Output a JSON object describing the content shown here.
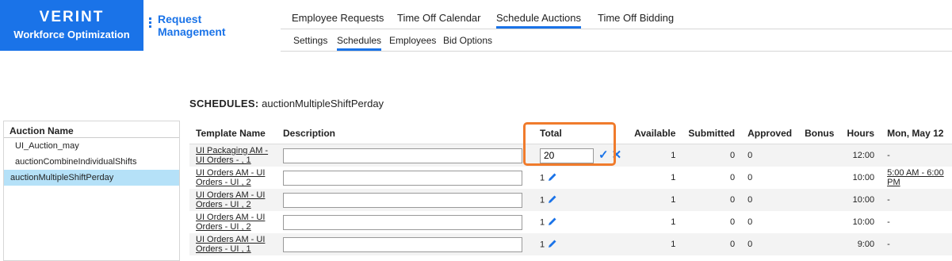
{
  "brand": {
    "logo": "VERINT",
    "subtitle": "Workforce Optimization"
  },
  "module": {
    "line1": "Request",
    "line2": "Management"
  },
  "topnav": [
    "Employee Requests",
    "Time Off Calendar",
    "Schedule Auctions",
    "Time Off Bidding"
  ],
  "topnav_active": "Schedule Auctions",
  "subnav": [
    "Settings",
    "Schedules",
    "Employees",
    "Bid Options"
  ],
  "subnav_active": "Schedules",
  "page": {
    "heading_label": "SCHEDULES:",
    "heading_value": " auctionMultipleShiftPerday"
  },
  "auction_list": {
    "header": "Auction Name",
    "items": [
      "UI_Auction_may",
      "auctionCombineIndividualShifts",
      "auctionMultipleShiftPerday"
    ],
    "selected": "auctionMultipleShiftPerday"
  },
  "table": {
    "columns": [
      "Template Name",
      "Description",
      "Total",
      "Available",
      "Submitted",
      "Approved",
      "Bonus",
      "Hours",
      "Mon, May 12"
    ],
    "rows": [
      {
        "template": "UI Packaging AM - UI Orders - , 1",
        "description": "",
        "total": "20",
        "editing": true,
        "available": "1",
        "submitted": "0",
        "approved": "0",
        "bonus": "",
        "hours": "12:00",
        "mon": "-"
      },
      {
        "template": "UI Orders AM - UI Orders - UI , 2",
        "description": "",
        "total": "1",
        "editing": false,
        "available": "1",
        "submitted": "0",
        "approved": "0",
        "bonus": "",
        "hours": "10:00",
        "mon": "5:00 AM - 6:00 PM"
      },
      {
        "template": "UI Orders AM - UI Orders - UI , 2",
        "description": "",
        "total": "1",
        "editing": false,
        "available": "1",
        "submitted": "0",
        "approved": "0",
        "bonus": "",
        "hours": "10:00",
        "mon": "-"
      },
      {
        "template": "UI Orders AM - UI Orders - UI , 2",
        "description": "",
        "total": "1",
        "editing": false,
        "available": "1",
        "submitted": "0",
        "approved": "0",
        "bonus": "",
        "hours": "10:00",
        "mon": "-"
      },
      {
        "template": "UI Orders AM - UI Orders - UI , 1",
        "description": "",
        "total": "1",
        "editing": false,
        "available": "1",
        "submitted": "0",
        "approved": "0",
        "bonus": "",
        "hours": "9:00",
        "mon": "-"
      }
    ]
  },
  "icons": {
    "edit": "pencil-icon",
    "confirm": "check-icon",
    "cancel": "close-icon"
  },
  "colors": {
    "brand": "#1a73e8",
    "highlight": "#f07b2c",
    "selected_row": "#b5e1f8"
  }
}
